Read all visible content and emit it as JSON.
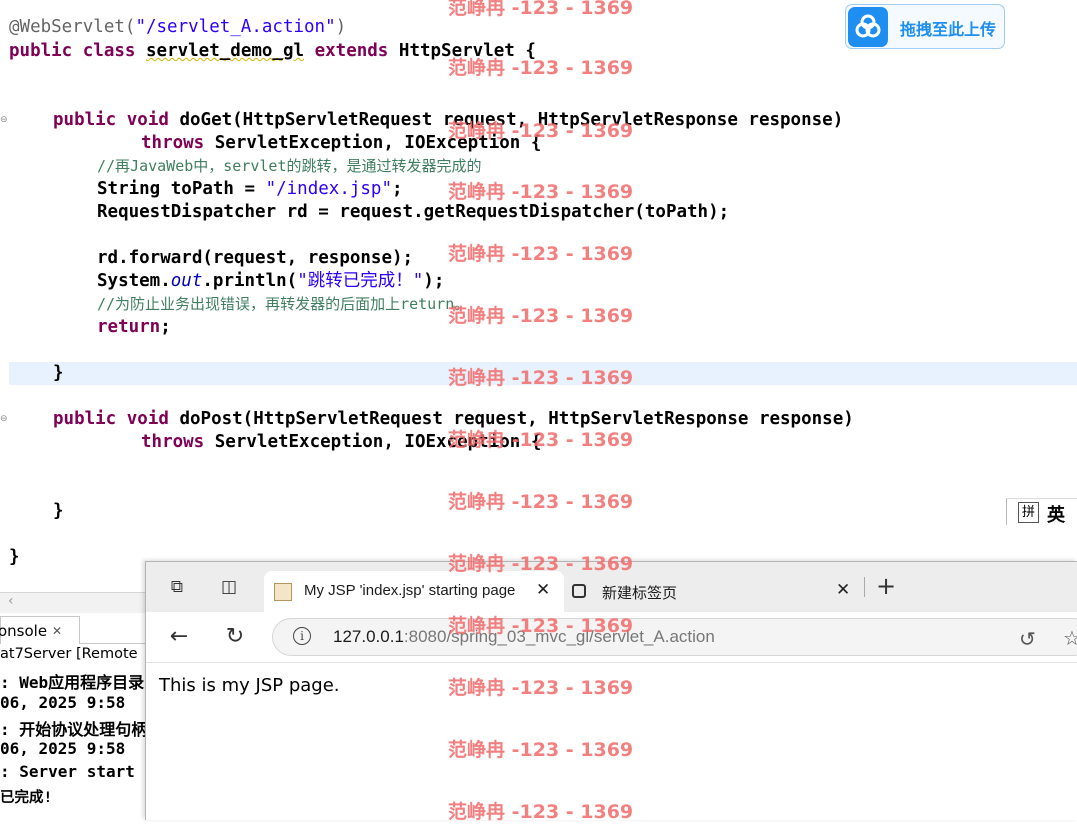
{
  "editor": {
    "lines": {
      "l0": {
        "ann": "@WebServlet(",
        "str": "\"/servlet_A.action\"",
        "tail": ")"
      },
      "l1": {
        "kw1": "public",
        "kw2": "class",
        "name": "servlet_demo_gl",
        "kw3": "extends",
        "rest": "HttpServlet {"
      },
      "l2": {
        "kw1": "public",
        "kw2": "void",
        "rest": "doGet(HttpServletRequest request, HttpServletResponse response)"
      },
      "l3": {
        "kw": "throws",
        "rest": "ServletException, IOException {"
      },
      "l4": {
        "comment": "//再JavaWeb中，servlet的跳转，是通过转发器完成的"
      },
      "l5": {
        "pre": "String toPath = ",
        "str": "\"/index.jsp\"",
        "tail": ";"
      },
      "l6": {
        "text": "RequestDispatcher rd = request.getRequestDispatcher(toPath);"
      },
      "l7": {
        "text": "rd.forward(request, response);"
      },
      "l8": {
        "pre": "System.",
        "field": "out",
        "mid": ".println(",
        "str": "\"跳转已完成！\"",
        "tail": ");"
      },
      "l9": {
        "comment": "//为防止业务出现错误，再转发器的后面加上return。"
      },
      "l10": {
        "kw": "return",
        "tail": ";"
      },
      "l11": {
        "text": "}"
      },
      "l12": {
        "kw1": "public",
        "kw2": "void",
        "rest": "doPost(HttpServletRequest request, HttpServletResponse response)"
      },
      "l13": {
        "kw": "throws",
        "rest": "ServletException, IOException {"
      },
      "l14": {
        "text": "}"
      },
      "l15": {
        "text": "}"
      }
    },
    "scroll_left_icon": "‹"
  },
  "upload": {
    "label": "拖拽至此上传",
    "icon": "cloud-icon"
  },
  "ime": {
    "mode": "拼",
    "lang": "英"
  },
  "console": {
    "tab_label": "onsole",
    "close_glyph": "✕",
    "description": "at7Server [Remote",
    "lines": [
      ": Web应用程序目录",
      "06, 2025 9:58",
      ": 开始协议处理句柄",
      "06, 2025 9:58",
      ": Server start",
      "已完成!"
    ]
  },
  "browser": {
    "tabs": [
      {
        "title": "My JSP 'index.jsp' starting page",
        "close": "✕"
      },
      {
        "title": "新建标签页",
        "close": "✕"
      }
    ],
    "new_tab": "+",
    "url_host": "127.0.0.1",
    "url_path": ":8080/spring_03_mvc_gl/servlet_A.action",
    "page_text": "This is my JSP page."
  },
  "watermark": {
    "text": "范峥冉 -123 - 1369",
    "color": "#f26b6b"
  },
  "colors": {
    "keyword": "#7f0055",
    "string": "#2a00ff",
    "comment": "#3f7f5f",
    "annotation": "#646464",
    "upload_accent": "#1e8ef0"
  }
}
